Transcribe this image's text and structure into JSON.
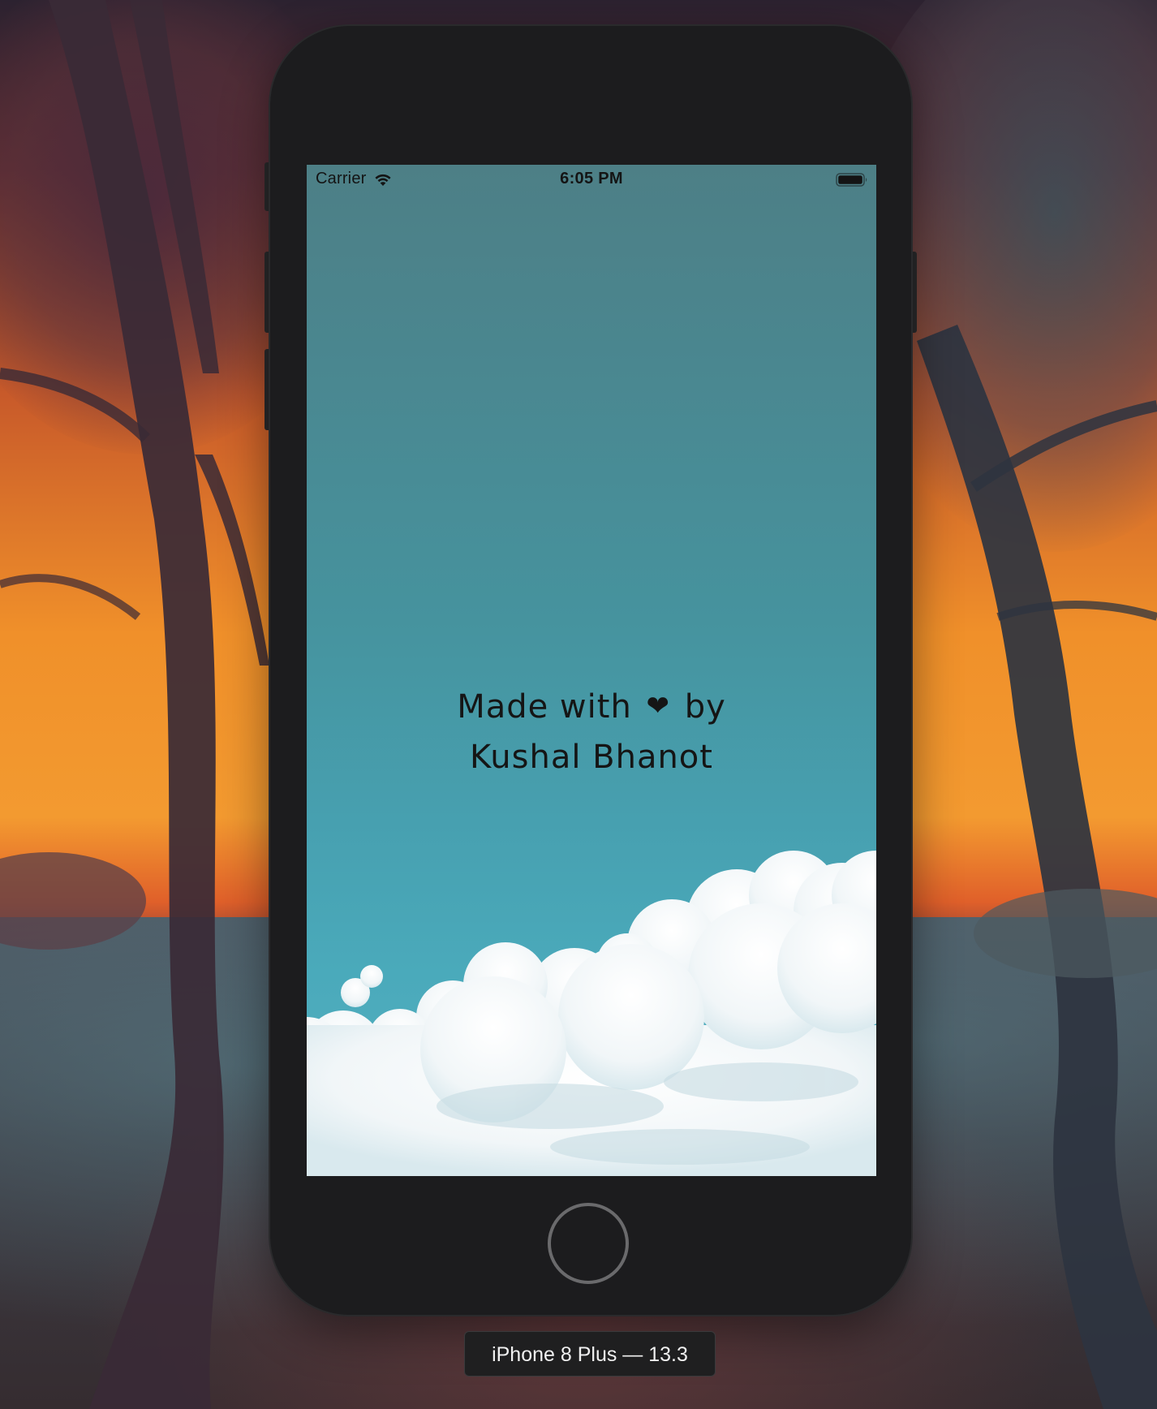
{
  "status_bar": {
    "carrier": "Carrier",
    "time": "6:05 PM",
    "wifi_icon": "wifi-icon",
    "battery_icon": "battery-full-icon"
  },
  "app": {
    "credit_line_1_before": "Made with",
    "heart_glyph": "❤",
    "credit_line_1_after": "by",
    "credit_line_2": "Kushal Bhanot"
  },
  "simulator": {
    "device_label": "iPhone 8 Plus — 13.3",
    "home_button_icon": "home-button-ring"
  },
  "colors": {
    "sky_top": "#4d7f86",
    "sky_bottom": "#58b0c0",
    "text": "#151515",
    "device_body": "#1c1c1e",
    "wallpaper_sunset": "#f0902a"
  }
}
